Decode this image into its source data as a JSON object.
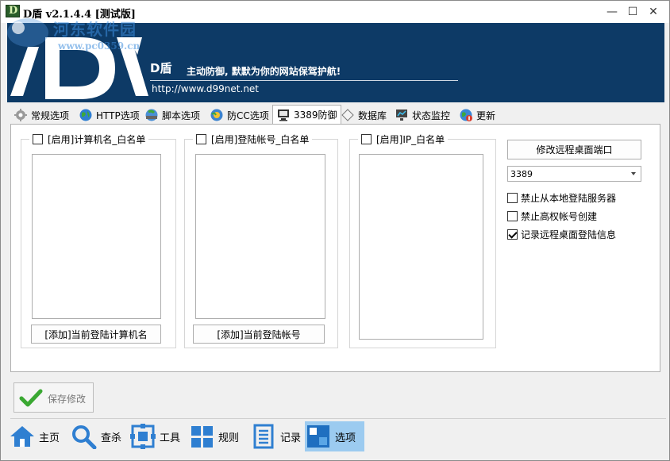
{
  "window": {
    "title": "D盾 v2.1.4.4 [测试版]",
    "min_glyph": "—",
    "max_glyph": "☐",
    "close_glyph": "✕"
  },
  "watermark": {
    "title": "河东软件园",
    "url": "www.pc0359.cn"
  },
  "banner": {
    "brand": "D盾",
    "slogan": "主动防御, 默默为你的网站保驾护航!",
    "url": "http://www.d99net.net"
  },
  "tabs": [
    {
      "label": "常规选项",
      "icon": "gear-icon"
    },
    {
      "label": "HTTP选项",
      "icon": "globe-icon"
    },
    {
      "label": "脚本选项",
      "icon": "script-globe-icon"
    },
    {
      "label": "防CC选项",
      "icon": "cc-globe-icon"
    },
    {
      "label": "3389防御",
      "icon": "monitor-icon"
    },
    {
      "label": "数据库",
      "icon": "diamond-icon"
    },
    {
      "label": "状态监控",
      "icon": "monitor-chart-icon"
    },
    {
      "label": "更新",
      "icon": "update-globe-icon"
    }
  ],
  "active_tab": "3389防御",
  "panel": {
    "computer_whitelist": {
      "enable_label": "[启用]计算机名_白名单",
      "enabled": false,
      "add_button": "[添加]当前登陆计算机名"
    },
    "account_whitelist": {
      "enable_label": "[启用]登陆帐号_白名单",
      "enabled": false,
      "add_button": "[添加]当前登陆帐号"
    },
    "ip_whitelist": {
      "enable_label": "[启用]IP_白名单",
      "enabled": false
    },
    "modify_port_button": "修改远程桌面端口",
    "port_value": "3389",
    "options": [
      {
        "label": "禁止从本地登陆服务器",
        "checked": false
      },
      {
        "label": "禁止高权帐号创建",
        "checked": false
      },
      {
        "label": "记录远程桌面登陆信息",
        "checked": true
      }
    ]
  },
  "save_button": "保存修改",
  "nav": [
    {
      "label": "主页",
      "icon": "home-icon"
    },
    {
      "label": "查杀",
      "icon": "search-icon"
    },
    {
      "label": "工具",
      "icon": "tools-icon"
    },
    {
      "label": "规则",
      "icon": "grid-icon"
    },
    {
      "label": "记录",
      "icon": "document-icon"
    },
    {
      "label": "选项",
      "icon": "options-icon"
    }
  ],
  "active_nav": "选项",
  "colors": {
    "banner_bg": "#0d3a66",
    "nav_active": "#9ccbf0",
    "check_green": "#3aa832"
  }
}
